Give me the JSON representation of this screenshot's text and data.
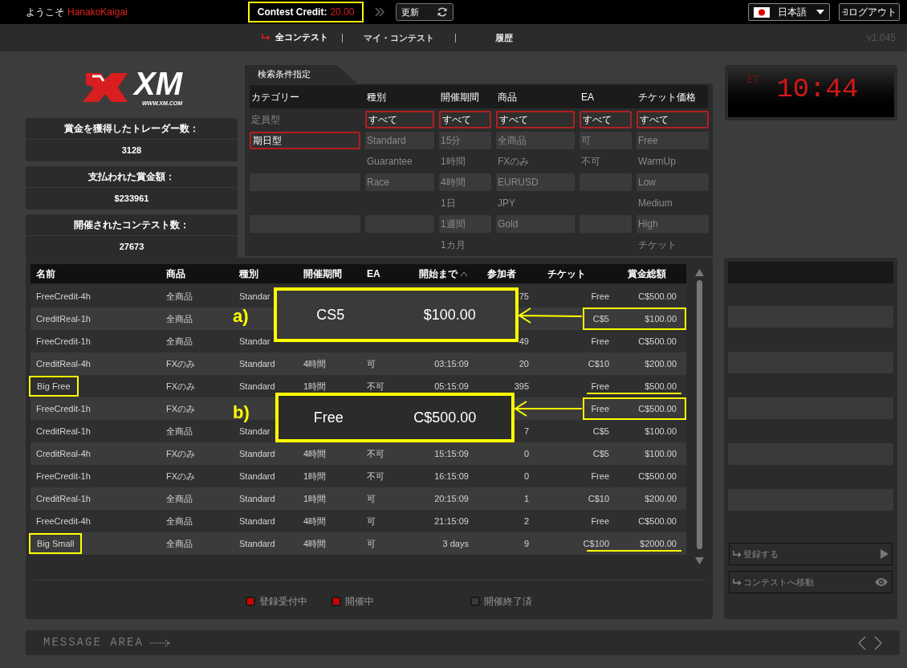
{
  "header": {
    "welcome": "ようこそ",
    "user": "HanakoKaigai",
    "credit_label": "Contest Credit:",
    "credit_value": "20.00",
    "credit_boxed": true,
    "refresh": "更新",
    "language": "日本語",
    "logout": "ログアウト"
  },
  "nav": {
    "tabs": [
      {
        "label": "全コンテスト",
        "selected": true
      },
      {
        "label": "マイ・コンテスト",
        "selected": false
      },
      {
        "label": "履歴",
        "selected": false
      }
    ],
    "version": "v1.045"
  },
  "logo": {
    "mark": "XM",
    "url": "WWW.XM.COM"
  },
  "stats": [
    {
      "label": "賞金を獲得したトレーダー数：",
      "value": "3128"
    },
    {
      "label": "支払われた賞金額：",
      "value": "$233961"
    },
    {
      "label": "開催されたコンテスト数：",
      "value": "27673"
    }
  ],
  "filter": {
    "title": "検索条件指定",
    "columns": [
      {
        "heading": "カテゴリー",
        "options": [
          {
            "label": "定員型",
            "selected": false
          },
          {
            "label": "期日型",
            "selected": true
          }
        ]
      },
      {
        "heading": "種別",
        "options": [
          {
            "label": "すべて",
            "selected": true
          },
          {
            "label": "Standard",
            "selected": false
          },
          {
            "label": "Guarantee",
            "selected": false
          },
          {
            "label": "Race",
            "selected": false
          }
        ]
      },
      {
        "heading": "開催期間",
        "options": [
          {
            "label": "すべて",
            "selected": true
          },
          {
            "label": "15分",
            "selected": false
          },
          {
            "label": "1時間",
            "selected": false
          },
          {
            "label": "4時間",
            "selected": false
          },
          {
            "label": "1日",
            "selected": false
          },
          {
            "label": "1週間",
            "selected": false
          },
          {
            "label": "1カ月",
            "selected": false
          }
        ]
      },
      {
        "heading": "商品",
        "options": [
          {
            "label": "すべて",
            "selected": true
          },
          {
            "label": "全商品",
            "selected": false
          },
          {
            "label": "FXのみ",
            "selected": false
          },
          {
            "label": "EURUSD",
            "selected": false
          },
          {
            "label": "JPY",
            "selected": false
          },
          {
            "label": "Gold",
            "selected": false
          }
        ]
      },
      {
        "heading": "EA",
        "options": [
          {
            "label": "すべて",
            "selected": true
          },
          {
            "label": "可",
            "selected": false
          },
          {
            "label": "不可",
            "selected": false
          }
        ]
      },
      {
        "heading": "チケット価格",
        "options": [
          {
            "label": "すべて",
            "selected": true
          },
          {
            "label": "Free",
            "selected": false
          },
          {
            "label": "WarmUp",
            "selected": false
          },
          {
            "label": "Low",
            "selected": false
          },
          {
            "label": "Medium",
            "selected": false
          },
          {
            "label": "High",
            "selected": false
          },
          {
            "label": "チケット",
            "selected": false
          }
        ]
      }
    ]
  },
  "clock": {
    "zone": "ET",
    "time": "10:44"
  },
  "table": {
    "columns": [
      {
        "label": "名前"
      },
      {
        "label": "商品"
      },
      {
        "label": "種別"
      },
      {
        "label": "開催期間"
      },
      {
        "label": "EA"
      },
      {
        "label": "開始まで",
        "sorted": true
      },
      {
        "label": "参加者"
      },
      {
        "label": "チケット"
      },
      {
        "label": "賞金総額"
      }
    ],
    "rows": [
      {
        "name": "FreeCredit-4h",
        "name_boxed": false,
        "product": "全商品",
        "type": "Standar",
        "participants": "75",
        "ticket": "Free",
        "prize": "C$500.00"
      },
      {
        "name": "CreditReal-1h",
        "name_boxed": false,
        "product": "全商品",
        "ticket": "C$5",
        "prize": "$100.00",
        "prize_boxed": true
      },
      {
        "name": "FreeCredit-1h",
        "name_boxed": false,
        "product": "全商品",
        "type": "Standar",
        "participants": "49",
        "ticket": "Free",
        "prize": "C$500.00"
      },
      {
        "name": "CreditReal-4h",
        "name_boxed": false,
        "product": "FXのみ",
        "type": "Standard",
        "duration": "4時間",
        "ea": "可",
        "start": "03:15:09",
        "participants": "20",
        "ticket": "C$10",
        "prize": "$200.00"
      },
      {
        "name": "Big Free",
        "name_boxed": true,
        "product": "FXのみ",
        "type": "Standard",
        "duration": "1時間",
        "ea": "不可",
        "start": "05:15:09",
        "participants": "395",
        "ticket": "Free",
        "prize": "$500.00",
        "prize_underlined": true
      },
      {
        "name": "FreeCredit-1h",
        "name_boxed": false,
        "product": "FXのみ",
        "ticket": "Free",
        "prize": "C$500.00",
        "prize_boxed": true
      },
      {
        "name": "CreditReal-1h",
        "name_boxed": false,
        "product": "全商品",
        "type": "Standar",
        "participants": "7",
        "ticket": "C$5",
        "prize": "$100.00"
      },
      {
        "name": "CreditReal-4h",
        "name_boxed": false,
        "product": "FXのみ",
        "type": "Standard",
        "duration": "4時間",
        "ea": "不可",
        "start": "15:15:09",
        "participants": "0",
        "ticket": "C$5",
        "prize": "$100.00"
      },
      {
        "name": "FreeCredit-1h",
        "name_boxed": false,
        "product": "FXのみ",
        "type": "Standard",
        "duration": "1時間",
        "ea": "不可",
        "start": "16:15:09",
        "participants": "0",
        "ticket": "Free",
        "prize": "C$500.00"
      },
      {
        "name": "CreditReal-1h",
        "name_boxed": false,
        "product": "全商品",
        "type": "Standard",
        "duration": "1時間",
        "ea": "可",
        "start": "20:15:09",
        "participants": "1",
        "ticket": "C$10",
        "prize": "$200.00"
      },
      {
        "name": "FreeCredit-4h",
        "name_boxed": false,
        "product": "全商品",
        "type": "Standard",
        "duration": "4時間",
        "ea": "可",
        "start": "21:15:09",
        "participants": "2",
        "ticket": "Free",
        "prize": "C$500.00"
      },
      {
        "name": "Big Small",
        "name_boxed": true,
        "product": "全商品",
        "type": "Standard",
        "duration": "4時間",
        "ea": "可",
        "start": "3 days",
        "participants": "9",
        "ticket": "C$100",
        "prize": "$2000.00",
        "prize_underlined": true
      }
    ],
    "callouts": [
      {
        "label": "a)",
        "ticket": "CS5",
        "prize": "$100.00"
      },
      {
        "label": "b)",
        "ticket": "Free",
        "prize": "C$500.00"
      }
    ]
  },
  "legend": [
    {
      "label": "登録受付中",
      "color": "#cc0000"
    },
    {
      "label": "開催中",
      "color": "#cc0000"
    },
    {
      "label": "開催終了済",
      "color": "#3a3a3a"
    }
  ],
  "side_panel": {
    "buttons": [
      {
        "kind": "register",
        "label": "登録する"
      },
      {
        "kind": "view",
        "label": "コンテストへ移動"
      }
    ]
  },
  "message_area": {
    "text": "MESSAGE AREA"
  }
}
